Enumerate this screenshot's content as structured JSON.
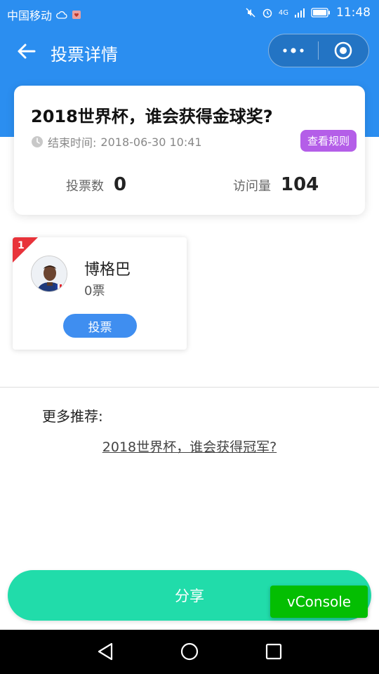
{
  "status_bar": {
    "carrier": "中国移动",
    "time": "11:48",
    "network": "4G"
  },
  "nav": {
    "title": "投票详情",
    "back_icon": "arrow-left-icon",
    "more_icon": "more-dots-icon",
    "close_icon": "target-circle-icon"
  },
  "vote": {
    "title": "2018世界杯，谁会获得金球奖?",
    "end_time_label": "结束时间:",
    "end_time": "2018-06-30 10:41",
    "rules_label": "查看规则",
    "vote_count_label": "投票数",
    "vote_count": "0",
    "visit_count_label": "访问量",
    "visit_count": "104"
  },
  "candidates": [
    {
      "rank": "1",
      "name": "博格巴",
      "votes": "0票",
      "vote_button": "投票"
    }
  ],
  "recommend": {
    "label": "更多推荐:",
    "link": "2018世界杯，谁会获得冠军?"
  },
  "share_label": "分享",
  "vconsole_label": "vConsole",
  "colors": {
    "header": "#2b8ef0",
    "rules": "#b45ee8",
    "vote_button": "#3f8ef0",
    "share": "#21dcaa",
    "vconsole": "#04be02",
    "rank": "#e8333a"
  }
}
